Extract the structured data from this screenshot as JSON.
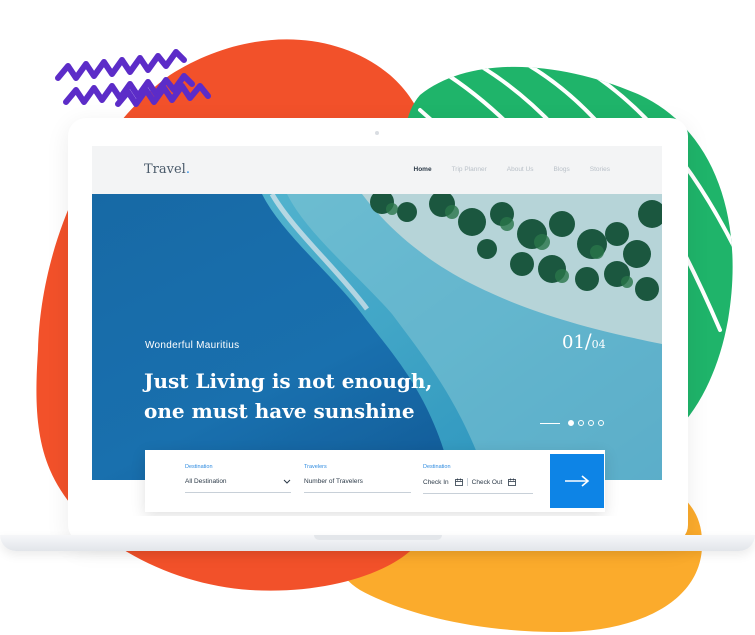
{
  "brand": {
    "name": "Travel",
    "dot": "."
  },
  "nav": {
    "items": [
      {
        "label": "Home",
        "active": true
      },
      {
        "label": "Trip Planner",
        "active": false
      },
      {
        "label": "About Us",
        "active": false
      },
      {
        "label": "Blogs",
        "active": false
      },
      {
        "label": "Stories",
        "active": false
      }
    ]
  },
  "hero": {
    "subtitle": "Wonderful Mauritius",
    "title_line1": "Just Living is not enough,",
    "title_line2": "one must have sunshine",
    "slide_current": "01",
    "slide_total": "04",
    "slides_count": 4,
    "active_slide_index": 0
  },
  "search": {
    "destination": {
      "label": "Destination",
      "value": "All Destination"
    },
    "travelers": {
      "label": "Travelers",
      "placeholder": "Number of Travelers"
    },
    "dates": {
      "label": "Destination",
      "check_in": "Check In",
      "check_out": "Check Out"
    },
    "submit_icon": "arrow-right-icon"
  },
  "colors": {
    "accent": "#0d84e6",
    "blob_orange": "#f2512a",
    "blob_green": "#1fb46a",
    "blob_yellow": "#fbab2c",
    "squiggle_purple": "#5c2cc8"
  },
  "icons": {
    "dropdown": "chevron-down-icon",
    "calendar": "calendar-icon",
    "squiggle": "squiggle-lines-icon"
  }
}
